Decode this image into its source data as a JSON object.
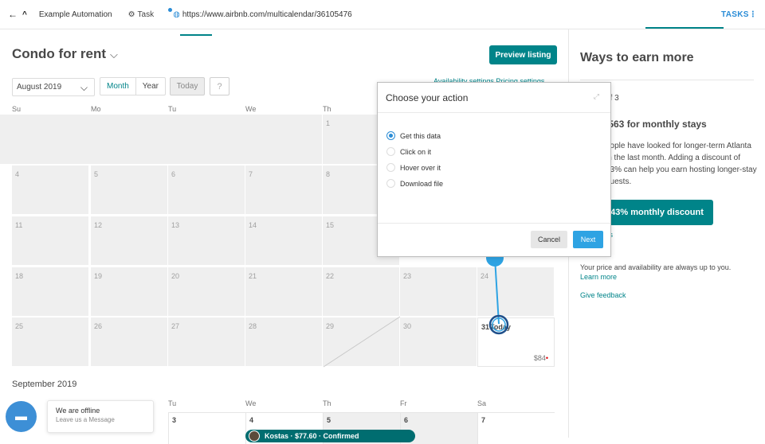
{
  "topbar": {
    "back": "←",
    "up": "^",
    "project": "Example Automation",
    "task": "Task",
    "url": "https://www.airbnb.com/multicalendar/36105476",
    "tasks_label": "TASKS"
  },
  "header": {
    "title": "Condo for rent",
    "preview_button": "Preview listing",
    "month_select": "August 2019",
    "view_month": "Month",
    "view_year": "Year",
    "today": "Today",
    "help": "?",
    "settings_links": "Availability settings   Pricing settings"
  },
  "calendar": {
    "days_of_week": [
      "Su",
      "Mo",
      "Tu",
      "We",
      "Th"
    ],
    "week1": [
      "1"
    ],
    "week2": [
      "4",
      "5",
      "6",
      "7",
      "8"
    ],
    "week3": [
      "11",
      "12",
      "13",
      "14",
      "15"
    ],
    "week4": [
      "18",
      "19",
      "20",
      "21",
      "22",
      "23",
      "24"
    ],
    "week5": [
      "25",
      "26",
      "27",
      "28",
      "29",
      "30",
      "31"
    ],
    "today_label": "Today",
    "price": "$84",
    "price_marker": "•"
  },
  "september": {
    "title": "September 2019",
    "days_of_week": [
      "Tu",
      "We",
      "Th",
      "Fr",
      "Sa"
    ],
    "dates": [
      "3",
      "4",
      "5",
      "6",
      "7"
    ],
    "booking": "Kostas · $77.60 · Confirmed"
  },
  "right_panel": {
    "title": "Ways to earn more",
    "counter": "of 3",
    "monthly_title": ",563 for monthly stays",
    "description": "eople have looked for longer-term Atlanta in the last month. Adding a discount of 43% can help you earn hosting longer-stay guests.",
    "discount_button": "43% monthly discount",
    "tasks_link": "ks",
    "note": "Your price and availability are always up to you.",
    "learn_more": "Learn more",
    "feedback": "Give feedback"
  },
  "dialog": {
    "title": "Choose your action",
    "options": [
      "Get this data",
      "Click on it",
      "Hover over it",
      "Download file"
    ],
    "selected": "Get this data",
    "cancel": "Cancel",
    "next": "Next"
  },
  "chat": {
    "status": "We are offline",
    "sub": "Leave us a Message"
  },
  "colors": {
    "accent": "#008489",
    "picker_blue": "#2ea3e3",
    "price_red": "#e00007"
  }
}
